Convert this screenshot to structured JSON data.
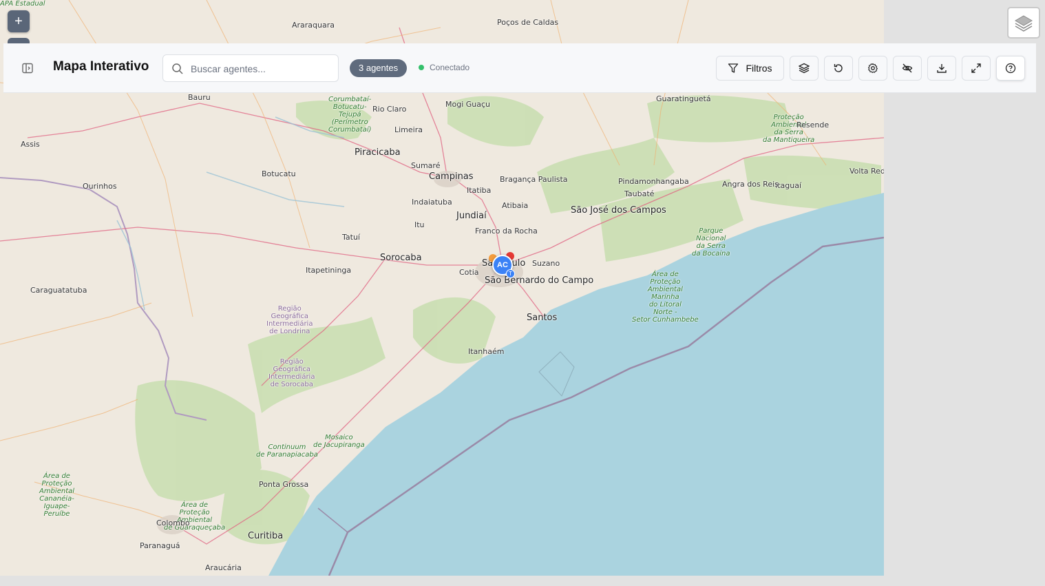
{
  "header": {
    "title": "Mapa Interativo",
    "search_placeholder": "Buscar agentes...",
    "agents_badge": "3 agentes",
    "status": "Conectado",
    "filter_label": "Filtros"
  },
  "map": {
    "zoom_in_label": "+",
    "marker": {
      "initials": "AC",
      "sub": "T"
    },
    "labels": [
      {
        "t": "Araraquara",
        "k": "n"
      },
      {
        "t": "Poços de\nCaldas",
        "k": "n"
      },
      {
        "t": "Bauru",
        "k": "n"
      },
      {
        "t": "Corumbataí-\nBotucatu-\nTejupá\n(Perímetro\nCorumbataí)",
        "k": "g"
      },
      {
        "t": "Rio Claro",
        "k": "n"
      },
      {
        "t": "Mogi Guaçu",
        "k": "n"
      },
      {
        "t": "Limeira",
        "k": "n"
      },
      {
        "t": "Assis",
        "k": "n"
      },
      {
        "t": "Piracicaba",
        "k": "b"
      },
      {
        "t": "Sumaré",
        "k": "n"
      },
      {
        "t": "Campinas",
        "k": "b"
      },
      {
        "t": "Bragança\nPaulista",
        "k": "n"
      },
      {
        "t": "Botucatu",
        "k": "n"
      },
      {
        "t": "Ourinhos",
        "k": "n"
      },
      {
        "t": "Itatiba",
        "k": "n"
      },
      {
        "t": "Indaiatuba",
        "k": "n"
      },
      {
        "t": "Atibaia",
        "k": "n"
      },
      {
        "t": "Jundiaí",
        "k": "b"
      },
      {
        "t": "Itu",
        "k": "n"
      },
      {
        "t": "Franco da\nRocha",
        "k": "n"
      },
      {
        "t": "Tatuí",
        "k": "n"
      },
      {
        "t": "Sorocaba",
        "k": "b"
      },
      {
        "t": "São Paulo",
        "k": "b"
      },
      {
        "t": "Suzano",
        "k": "n"
      },
      {
        "t": "Cotia",
        "k": "n"
      },
      {
        "t": "São Bernardo\ndo Campo",
        "k": "b"
      },
      {
        "t": "Itapetininga",
        "k": "n"
      },
      {
        "t": "Santos",
        "k": "b"
      },
      {
        "t": "Itanhaém",
        "k": "n"
      },
      {
        "t": "São José dos\nCampos",
        "k": "b"
      },
      {
        "t": "Taubaté",
        "k": "n"
      },
      {
        "t": "Pindamonhangaba",
        "k": "n"
      },
      {
        "t": "Guaratinguetá",
        "k": "n"
      },
      {
        "t": "Proteção\nAmbiental\nda Serra\nda Mantiqueira",
        "k": "g"
      },
      {
        "t": "Resende",
        "k": "n"
      },
      {
        "t": "Volta Redonda",
        "k": "n"
      },
      {
        "t": "Itaguaí",
        "k": "n"
      },
      {
        "t": "Angra dos\nReis",
        "k": "n"
      },
      {
        "t": "Parque\nNacional\nda Serra\nda Bocaina",
        "k": "g"
      },
      {
        "t": "Área de\nProteção\nAmbiental\nMarinha\ndo Litoral\nNorte -\nSetor Cunhambebe",
        "k": "g"
      },
      {
        "t": "Caraguatatuba",
        "k": "n"
      },
      {
        "t": "Região\nGeográfica\nIntermediária\nde Londrina",
        "k": "p"
      },
      {
        "t": "Região\nGeográfica\nIntermediária\nde Sorocaba",
        "k": "p"
      },
      {
        "t": "Continuum\nde Paranapiacaba",
        "k": "g"
      },
      {
        "t": "Mosaico\nde Jacupiranga",
        "k": "g"
      },
      {
        "t": "Área de\nProteção\nAmbiental\nCananéia-\nIguape-\nPeruíbe",
        "k": "g"
      },
      {
        "t": "Ponta Grossa",
        "k": "n"
      },
      {
        "t": "Área de\nProteção\nAmbiental\nde Guaraqueçaba",
        "k": "g"
      },
      {
        "t": "Colombo",
        "k": "n"
      },
      {
        "t": "Curitiba",
        "k": "b"
      },
      {
        "t": "Paranaguá",
        "k": "n"
      },
      {
        "t": "Araucária",
        "k": "n"
      },
      {
        "t": "APA Estadual",
        "k": "g"
      }
    ]
  },
  "colors": {
    "land": "#efe9df",
    "sea": "#aad3df",
    "forest": "#c8deb0",
    "status_dot": "#34c06b",
    "badge": "#5f6b7d",
    "marker": "#3b82f6"
  },
  "icons": [
    "sidebar-toggle-icon",
    "search-icon",
    "filter-icon",
    "layers-icon",
    "refresh-icon",
    "settings-icon",
    "eye-off-icon",
    "download-icon",
    "fullscreen-icon",
    "help-icon"
  ]
}
